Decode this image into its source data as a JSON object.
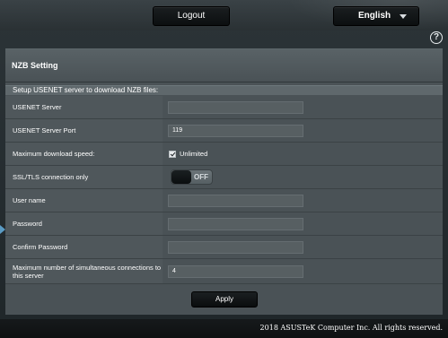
{
  "header": {
    "logout_label": "Logout",
    "language_label": "English",
    "help_symbol": "?"
  },
  "panel": {
    "title": "NZB Setting",
    "section_title": "Setup USENET server to download NZB files:"
  },
  "fields": {
    "usenet_server": {
      "label": "USENET Server",
      "value": ""
    },
    "usenet_server_port": {
      "label": "USENET Server Port",
      "value": "119"
    },
    "max_download_speed": {
      "label": "Maximum download speed:",
      "checkbox_label": "Unlimited",
      "checked": true
    },
    "ssl_tls_only": {
      "label": "SSL/TLS connection only",
      "state": "OFF"
    },
    "user_name": {
      "label": "User name",
      "value": ""
    },
    "password": {
      "label": "Password",
      "value": ""
    },
    "confirm_password": {
      "label": "Confirm Password",
      "value": ""
    },
    "max_connections": {
      "label": "Maximum number of simultaneous connections to this server",
      "value": "4"
    }
  },
  "actions": {
    "apply_label": "Apply"
  },
  "footer": {
    "copyright": "2018 ASUSTeK Computer Inc. All rights reserved."
  },
  "icons": {
    "help": "help-circle-icon",
    "language_caret": "caret-down-icon",
    "side_marker": "side-arrow-icon"
  },
  "colors": {
    "background": "#1f2629",
    "panel": "#4a5256",
    "label_cell": "#4f575b",
    "button": "#0c0f10",
    "accent": "#5a9bc4"
  }
}
